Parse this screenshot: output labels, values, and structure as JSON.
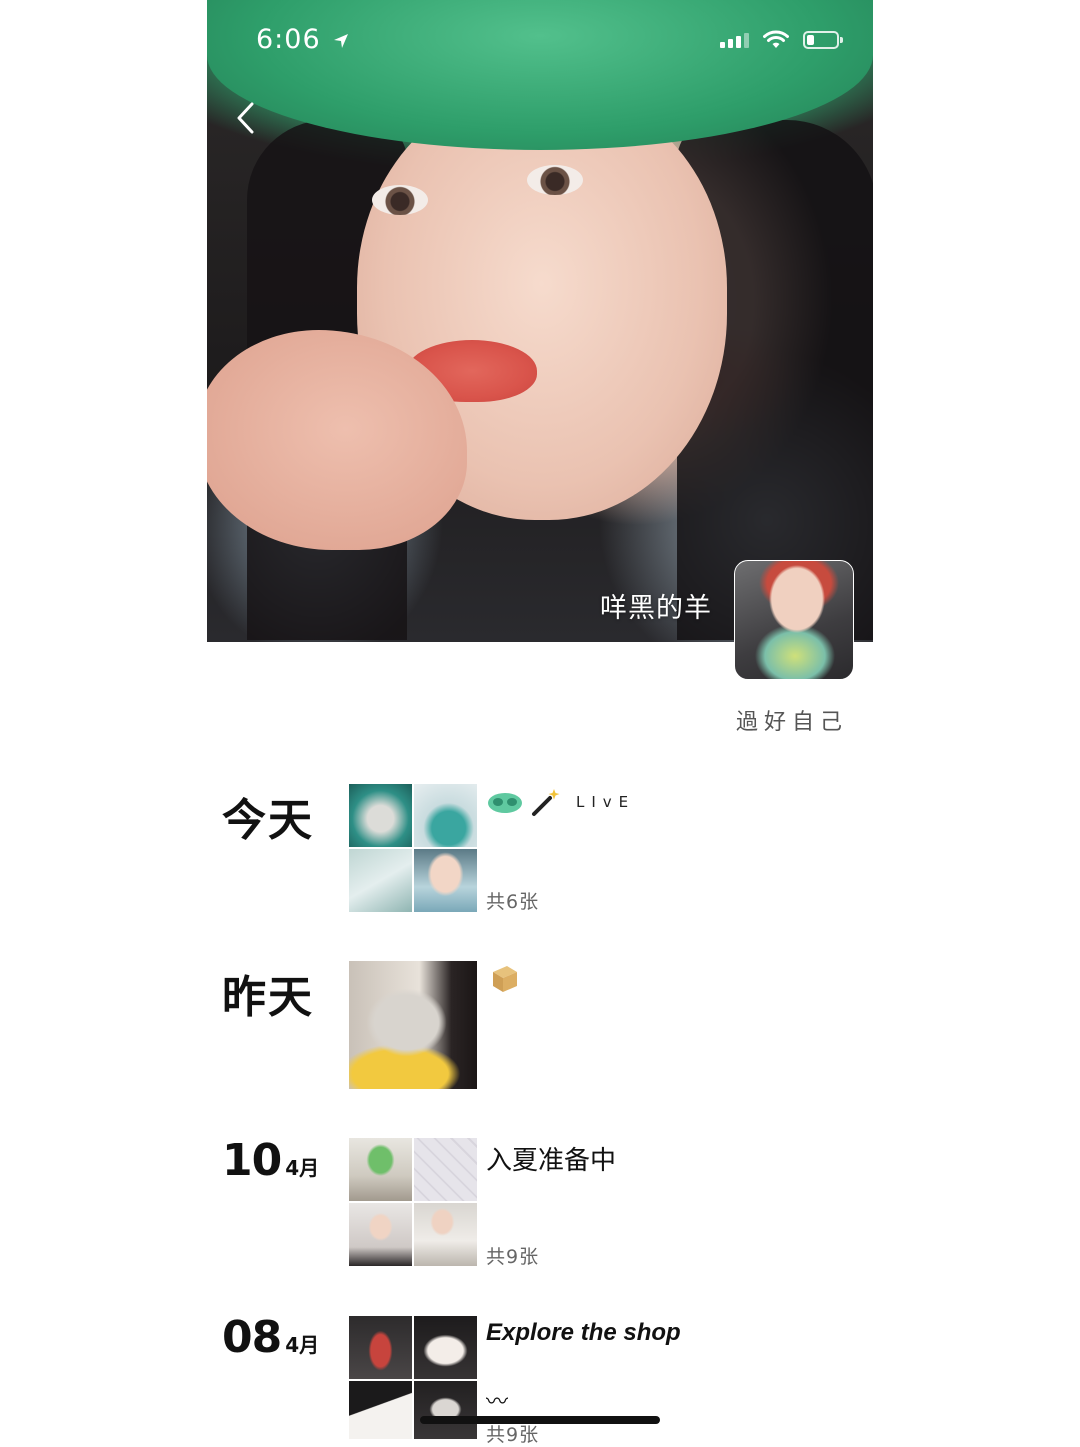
{
  "status_bar": {
    "time": "6:06"
  },
  "profile": {
    "name": "咩黑的羊",
    "bio": "過好自己"
  },
  "posts": [
    {
      "date_label": "今天",
      "caption": "LIvE",
      "count": "共6张"
    },
    {
      "date_label": "昨天",
      "caption": "",
      "count": ""
    },
    {
      "date_day": "10",
      "date_month": "4月",
      "caption": "入夏准备中",
      "count": "共9张"
    },
    {
      "date_day": "08",
      "date_month": "4月",
      "caption": "Explore the shop",
      "caption_2": "〰",
      "count": "共9张"
    }
  ],
  "colors": {
    "accent_green": "#2f9a68",
    "text": "#111111",
    "muted": "#666666"
  }
}
